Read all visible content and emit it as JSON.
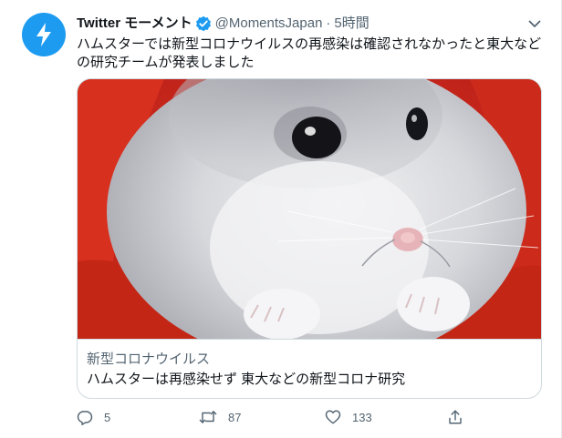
{
  "tweet": {
    "display_name": "Twitter モーメント",
    "handle": "@MomentsJapan",
    "separator": "·",
    "time": "5時間",
    "text": "ハムスターでは新型コロナウイルスの再感染は確認されなかったと東大などの研究チームが発表しました",
    "icons": {
      "avatar": "lightning-bolt-icon",
      "verified": "verified-badge-icon",
      "more": "chevron-down-icon"
    },
    "colors": {
      "accent": "#1d9bf0",
      "text": "#0f1419",
      "secondary": "#536471",
      "border": "#cfd9de"
    }
  },
  "card": {
    "image": "hamster-photo",
    "source": "新型コロナウイルス",
    "title": "ハムスターは再感染せず 東大などの新型コロナ研究"
  },
  "actions": {
    "reply": {
      "icon": "reply-icon",
      "count": "5"
    },
    "retweet": {
      "icon": "retweet-icon",
      "count": "87"
    },
    "like": {
      "icon": "heart-icon",
      "count": "133"
    },
    "share": {
      "icon": "share-icon"
    }
  }
}
